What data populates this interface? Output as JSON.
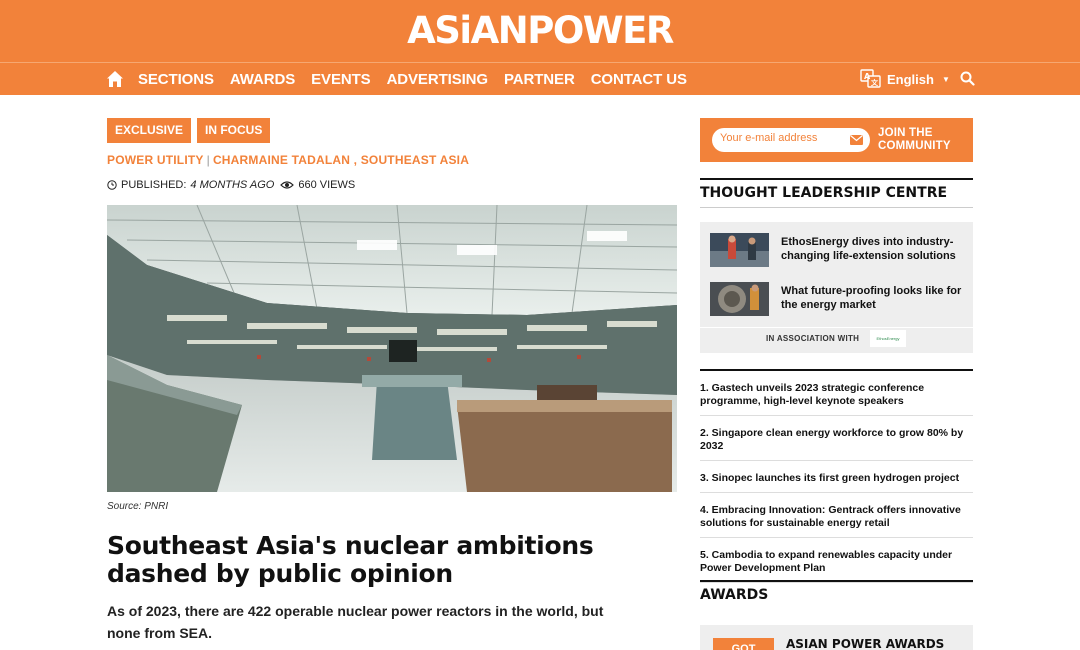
{
  "brand": {
    "logo_text": "ASiANPOWER",
    "accent_color": "#f2823a"
  },
  "nav": {
    "home_icon": "home-icon",
    "items": [
      "SECTIONS",
      "AWARDS",
      "EVENTS",
      "ADVERTISING",
      "PARTNER",
      "CONTACT US"
    ],
    "language": "English",
    "search_icon": "search-icon"
  },
  "article": {
    "tags": [
      "EXCLUSIVE",
      "IN FOCUS"
    ],
    "category": "POWER UTILITY",
    "byline": "CHARMAINE TADALAN , SOUTHEAST ASIA",
    "published_label": "PUBLISHED:",
    "published_value": "4 MONTHS AGO",
    "views": "660 VIEWS",
    "image_source": "Source: PNRI",
    "headline": "Southeast Asia's nuclear ambitions dashed by public opinion",
    "lead": "As of 2023, there are 422 operable nuclear power reactors in the world, but none from SEA."
  },
  "sidebar": {
    "newsletter": {
      "placeholder": "Your e-mail address",
      "join_label_line1": "JOIN THE",
      "join_label_line2": "COMMUNITY"
    },
    "thought_leadership": {
      "title": "THOUGHT LEADERSHIP CENTRE",
      "items": [
        "EthosEnergy dives into industry-changing life-extension solutions",
        "What future-proofing looks like for the energy market"
      ],
      "association_label": "IN ASSOCIATION WITH",
      "association_logo": "EthosEnergy"
    },
    "top_news": [
      "1. Gastech unveils 2023 strategic conference programme, high-level keynote speakers",
      "2. Singapore clean energy workforce to grow 80% by 2032",
      "3. Sinopec launches its first green hydrogen project",
      "4. Embracing Innovation: Gentrack offers innovative solutions for sustainable energy retail",
      "5. Cambodia to expand renewables capacity under Power Development Plan"
    ],
    "awards": {
      "title": "AWARDS",
      "badge": "GOT",
      "box_title": "ASIAN POWER AWARDS"
    }
  }
}
